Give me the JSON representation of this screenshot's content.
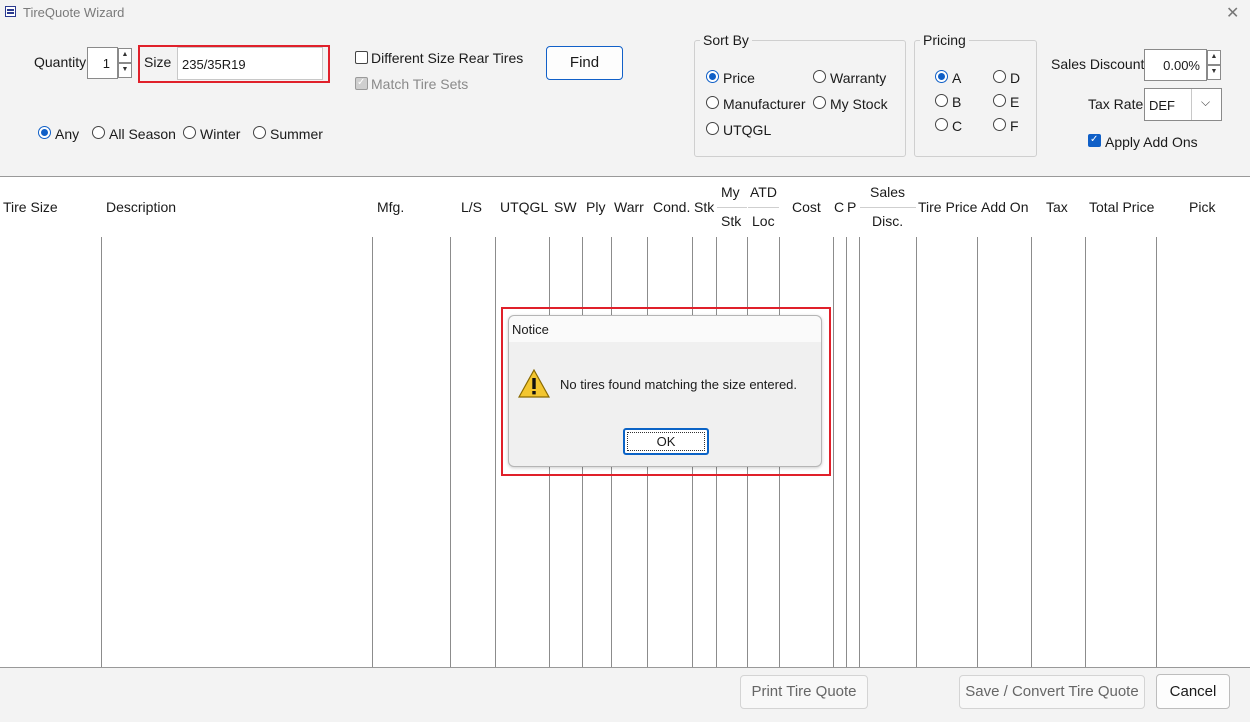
{
  "window": {
    "title": "TireQuote Wizard",
    "close_glyph": "✕"
  },
  "top": {
    "quantity_label": "Quantity",
    "quantity_value": "1",
    "size_label": "Size",
    "size_value": "235/35R19",
    "diff_rear_label": "Different Size Rear Tires",
    "match_sets_label": "Match Tire Sets",
    "find_label": "Find",
    "season_options": [
      "Any",
      "All Season",
      "Winter",
      "Summer"
    ],
    "season_selected": "Any"
  },
  "sort_by": {
    "title": "Sort By",
    "options": [
      "Price",
      "Warranty",
      "Manufacturer",
      "My Stock",
      "UTQGL"
    ],
    "selected": "Price"
  },
  "pricing": {
    "title": "Pricing",
    "options": [
      "A",
      "D",
      "B",
      "E",
      "C",
      "F"
    ],
    "selected": "A"
  },
  "right": {
    "sales_discount_label": "Sales Discount",
    "sales_discount_value": "0.00%",
    "tax_rate_label": "Tax Rate",
    "tax_rate_value": "DEF",
    "apply_addons_label": "Apply Add Ons"
  },
  "grid": {
    "columns": [
      "Tire Size",
      "Description",
      "Mfg.",
      "L/S",
      "UTQGL",
      "SW",
      "Ply",
      "Warr",
      "Cond.",
      "Stk",
      "My",
      "Stk",
      "ATD",
      "Loc",
      "Cost",
      "C",
      "P",
      "Sales",
      "Disc.",
      "Tire Price",
      "Add On",
      "Tax",
      "Total Price",
      "Pick"
    ]
  },
  "dialog": {
    "title": "Notice",
    "message": "No tires found matching the size entered.",
    "ok_label": "OK"
  },
  "footer": {
    "print_label": "Print Tire Quote",
    "save_label": "Save / Convert Tire Quote",
    "cancel_label": "Cancel"
  },
  "colors": {
    "accent": "#0f5fc7",
    "highlight_red": "#e0202a"
  },
  "icons": {
    "warning": "warning-icon",
    "close": "close-icon"
  }
}
